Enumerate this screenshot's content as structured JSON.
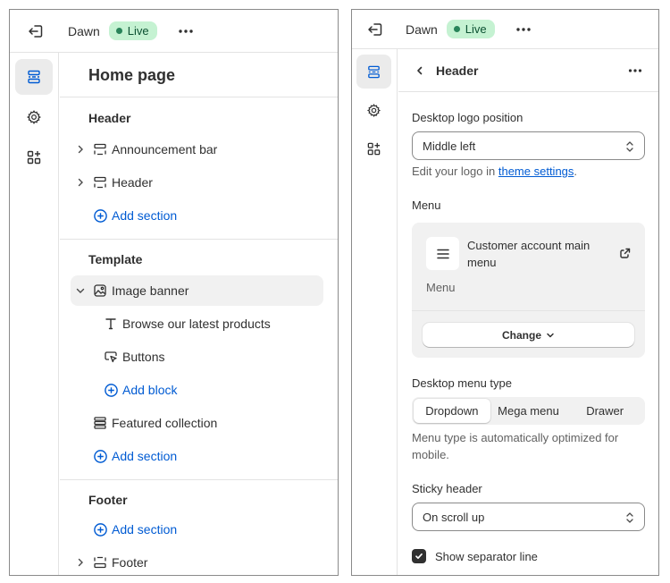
{
  "left": {
    "theme_name": "Dawn",
    "live_label": "Live",
    "page_title": "Home page",
    "header_group": {
      "title": "Header",
      "items": [
        "Announcement bar",
        "Header"
      ],
      "add_label": "Add section"
    },
    "template_group": {
      "title": "Template",
      "section": "Image banner",
      "blocks": [
        "Browse our latest products",
        "Buttons"
      ],
      "add_block_label": "Add block",
      "featured": "Featured collection",
      "add_label": "Add section"
    },
    "footer_group": {
      "title": "Footer",
      "add_label": "Add section",
      "item": "Footer"
    }
  },
  "right": {
    "theme_name": "Dawn",
    "live_label": "Live",
    "panel_title": "Header",
    "logo_position": {
      "label": "Desktop logo position",
      "value": "Middle left",
      "helper_prefix": "Edit your logo in",
      "helper_link": "theme settings",
      "helper_suffix": "."
    },
    "menu": {
      "label": "Menu",
      "name": "Customer account main menu",
      "sub": "Menu",
      "change_label": "Change"
    },
    "menu_type": {
      "label": "Desktop menu type",
      "options": [
        "Dropdown",
        "Mega menu",
        "Drawer"
      ],
      "selected": "Dropdown",
      "helper": "Menu type is automatically optimized for mobile."
    },
    "sticky": {
      "label": "Sticky header",
      "value": "On scroll up"
    },
    "separator": {
      "label": "Show separator line",
      "checked": true
    }
  },
  "colors": {
    "link": "#005bd3",
    "live_bg": "#c5f2d2",
    "live_dot": "#29845a",
    "text": "#303030",
    "subdued": "#616161"
  }
}
